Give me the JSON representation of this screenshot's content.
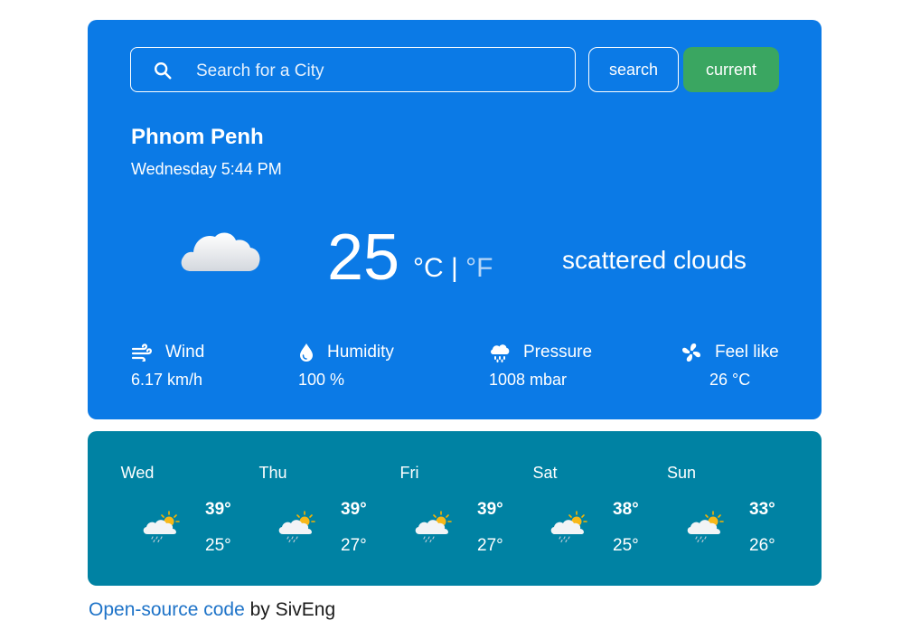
{
  "search": {
    "placeholder": "Search for a City",
    "search_label": "search",
    "current_label": "current"
  },
  "weather": {
    "city": "Phnom Penh",
    "datetime": "Wednesday 5:44 PM",
    "temperature": "25",
    "unit_c": "°C",
    "unit_sep": "|",
    "unit_f": "°F",
    "description": "scattered clouds",
    "icon": "cloud-icon"
  },
  "stats": {
    "wind": {
      "label": "Wind",
      "value": "6.17 km/h",
      "icon": "wind-icon"
    },
    "humidity": {
      "label": "Humidity",
      "value": "100 %",
      "icon": "droplet-icon"
    },
    "pressure": {
      "label": "Pressure",
      "value": "1008 mbar",
      "icon": "cloud-rain-icon"
    },
    "feel": {
      "label": "Feel like",
      "value": "26 °C",
      "icon": "fan-icon"
    }
  },
  "forecast": [
    {
      "day": "Wed",
      "high": "39°",
      "low": "25°",
      "icon": "partly-cloudy-rain-icon"
    },
    {
      "day": "Thu",
      "high": "39°",
      "low": "27°",
      "icon": "partly-cloudy-rain-icon"
    },
    {
      "day": "Fri",
      "high": "39°",
      "low": "27°",
      "icon": "partly-cloudy-rain-icon"
    },
    {
      "day": "Sat",
      "high": "38°",
      "low": "25°",
      "icon": "partly-cloudy-rain-icon"
    },
    {
      "day": "Sun",
      "high": "33°",
      "low": "26°",
      "icon": "partly-cloudy-rain-icon"
    }
  ],
  "footer": {
    "link_text": "Open-source code",
    "suffix": " by SivEng"
  },
  "colors": {
    "card": "#0b7ae6",
    "forecast_card": "#0082a3",
    "current_button": "#3aa661",
    "link": "#1e73c8"
  }
}
